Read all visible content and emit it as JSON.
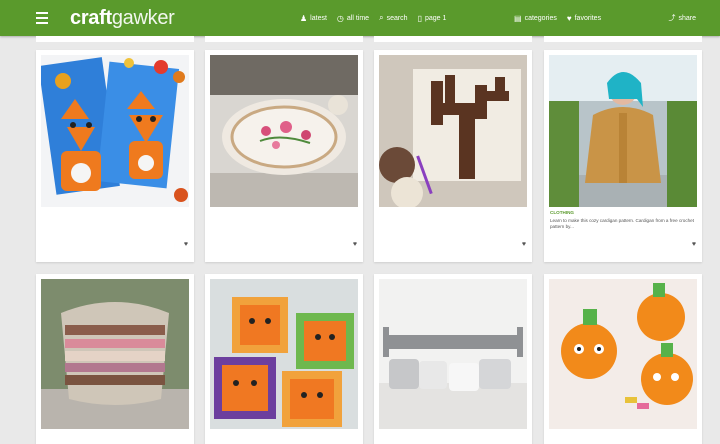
{
  "header": {
    "logo_bold": "craft",
    "logo_light": "gawker",
    "nav_left": [
      {
        "label": "latest",
        "icon": "person-icon",
        "glyph": "♟"
      },
      {
        "label": "all time",
        "icon": "clock-icon",
        "glyph": "◷"
      },
      {
        "label": "search",
        "icon": "search-icon",
        "glyph": "⌕"
      },
      {
        "label": "page 1",
        "icon": "page-icon",
        "glyph": "▯"
      }
    ],
    "nav_right": [
      {
        "label": "categories",
        "icon": "categories-icon",
        "glyph": "▤"
      },
      {
        "label": "favorites",
        "icon": "heart-icon",
        "glyph": "♥"
      }
    ],
    "share": {
      "label": "share",
      "glyph": "⤴"
    }
  },
  "colors": {
    "brand": "#5a9a2c",
    "background": "#e9e9e9"
  },
  "cards": [
    {
      "category": "CLOTHING",
      "source": "",
      "desc": "Learn to make this cozy cardigan pattern. Cardigan from a free crochet pattern by...",
      "likes": "",
      "views": ""
    }
  ]
}
